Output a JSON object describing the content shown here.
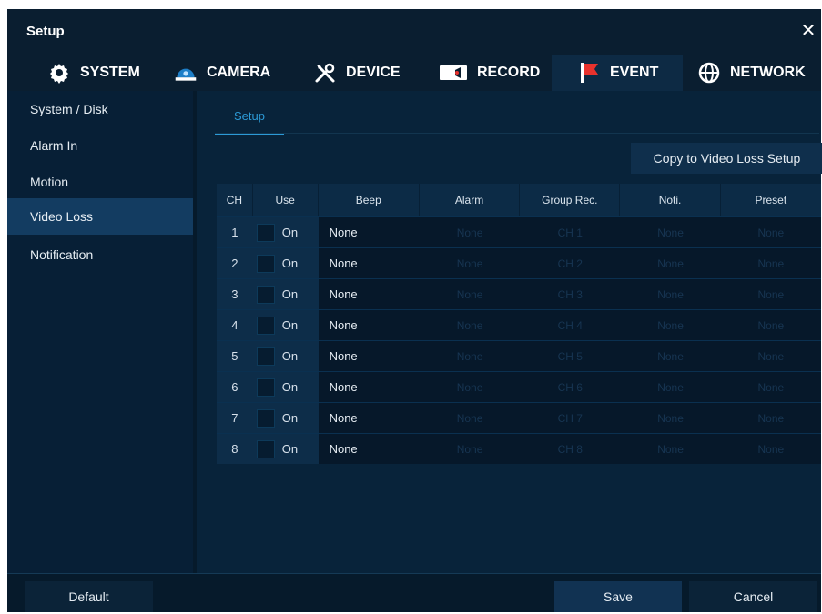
{
  "window": {
    "title": "Setup"
  },
  "tabs": [
    {
      "label": "SYSTEM",
      "icon": "gear-icon"
    },
    {
      "label": "CAMERA",
      "icon": "camera-icon"
    },
    {
      "label": "DEVICE",
      "icon": "tools-icon"
    },
    {
      "label": "RECORD",
      "icon": "record-icon"
    },
    {
      "label": "EVENT",
      "icon": "flag-icon"
    },
    {
      "label": "NETWORK",
      "icon": "globe-icon"
    }
  ],
  "active_tab": "EVENT",
  "sidebar": {
    "items": [
      {
        "label": "System / Disk"
      },
      {
        "label": "Alarm In"
      },
      {
        "label": "Motion"
      },
      {
        "label": "Video Loss"
      },
      {
        "label": "Notification"
      }
    ],
    "active": "Video Loss"
  },
  "main": {
    "subtab": "Setup",
    "copy_button": "Copy to Video Loss Setup",
    "table": {
      "headers": [
        "CH",
        "Use",
        "Beep",
        "Alarm",
        "Group Rec.",
        "Noti.",
        "Preset"
      ],
      "rows": [
        {
          "ch": "1",
          "use": "On",
          "beep": "None",
          "alarm": "None",
          "group_rec": "CH 1",
          "noti": "None",
          "preset": "None"
        },
        {
          "ch": "2",
          "use": "On",
          "beep": "None",
          "alarm": "None",
          "group_rec": "CH 2",
          "noti": "None",
          "preset": "None"
        },
        {
          "ch": "3",
          "use": "On",
          "beep": "None",
          "alarm": "None",
          "group_rec": "CH 3",
          "noti": "None",
          "preset": "None"
        },
        {
          "ch": "4",
          "use": "On",
          "beep": "None",
          "alarm": "None",
          "group_rec": "CH 4",
          "noti": "None",
          "preset": "None"
        },
        {
          "ch": "5",
          "use": "On",
          "beep": "None",
          "alarm": "None",
          "group_rec": "CH 5",
          "noti": "None",
          "preset": "None"
        },
        {
          "ch": "6",
          "use": "On",
          "beep": "None",
          "alarm": "None",
          "group_rec": "CH 6",
          "noti": "None",
          "preset": "None"
        },
        {
          "ch": "7",
          "use": "On",
          "beep": "None",
          "alarm": "None",
          "group_rec": "CH 7",
          "noti": "None",
          "preset": "None"
        },
        {
          "ch": "8",
          "use": "On",
          "beep": "None",
          "alarm": "None",
          "group_rec": "CH 8",
          "noti": "None",
          "preset": "None"
        }
      ]
    }
  },
  "footer": {
    "default": "Default",
    "save": "Save",
    "cancel": "Cancel"
  },
  "colors": {
    "accent": "#2c9ad6",
    "background": "#061a2b",
    "selected": "#133c61",
    "event_flag": "#e8322d",
    "camera_icon": "#1e7fc8"
  }
}
